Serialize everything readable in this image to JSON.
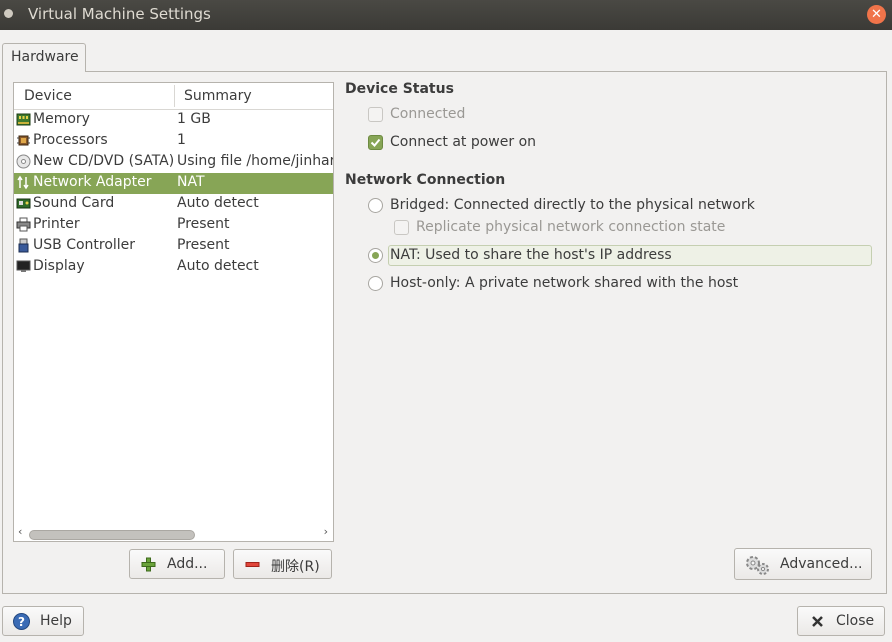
{
  "window": {
    "title": "Virtual Machine Settings"
  },
  "tabs": [
    {
      "label": "Hardware"
    }
  ],
  "device_list": {
    "columns": {
      "device": "Device",
      "summary": "Summary"
    },
    "rows": [
      {
        "icon": "memory-icon",
        "device": "Memory",
        "summary": "1 GB",
        "selected": false
      },
      {
        "icon": "processor-icon",
        "device": "Processors",
        "summary": "1",
        "selected": false
      },
      {
        "icon": "cd-dvd-icon",
        "device": "New CD/DVD (SATA)",
        "summary": "Using file /home/jinhar",
        "selected": false
      },
      {
        "icon": "network-adapter-icon",
        "device": "Network Adapter",
        "summary": "NAT",
        "selected": true
      },
      {
        "icon": "sound-card-icon",
        "device": "Sound Card",
        "summary": "Auto detect",
        "selected": false
      },
      {
        "icon": "printer-icon",
        "device": "Printer",
        "summary": "Present",
        "selected": false
      },
      {
        "icon": "usb-icon",
        "device": "USB Controller",
        "summary": "Present",
        "selected": false
      },
      {
        "icon": "display-icon",
        "device": "Display",
        "summary": "Auto detect",
        "selected": false
      }
    ]
  },
  "list_buttons": {
    "add": "Add...",
    "remove": "删除(R)"
  },
  "device_status": {
    "heading": "Device Status",
    "connected": {
      "label": "Connected",
      "checked": false,
      "disabled": true
    },
    "connect_at_power_on": {
      "label": "Connect at power on",
      "checked": true
    }
  },
  "network_connection": {
    "heading": "Network Connection",
    "bridged": {
      "label": "Bridged: Connected directly to the physical network",
      "selected": false
    },
    "replicate": {
      "label": "Replicate physical network connection state",
      "checked": false,
      "disabled": true
    },
    "nat": {
      "label": "NAT: Used to share the host's IP address",
      "selected": true
    },
    "host_only": {
      "label": "Host-only: A private network shared with the host",
      "selected": false
    }
  },
  "advanced_button": {
    "label": "Advanced..."
  },
  "footer": {
    "help": "Help",
    "close": "Close"
  },
  "colors": {
    "accent": "#87a556",
    "titlebar": "#3d3c38",
    "close_button": "#f0744a"
  }
}
